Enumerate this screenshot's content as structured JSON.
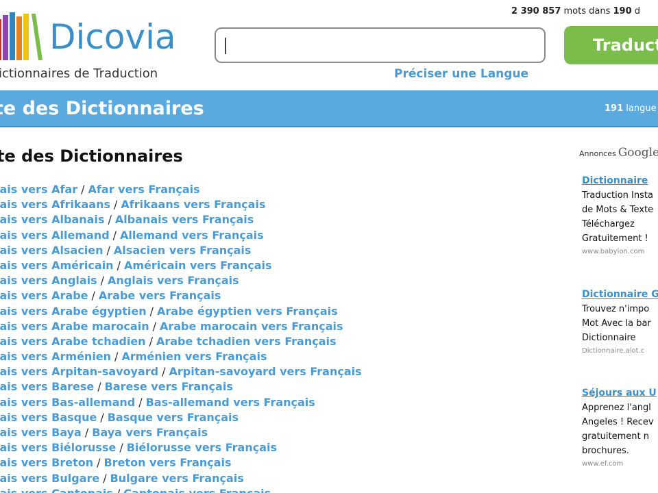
{
  "header": {
    "logo_text": "Dicovia",
    "tagline": "ictionnaires de Traduction",
    "word_count_number": "2 390 857",
    "word_count_mid": " mots dans ",
    "word_count_langs": "190",
    "word_count_tail": " d",
    "search": {
      "value": "",
      "placeholder": ""
    },
    "translate_button": "Traductio",
    "specify_language_link": "Préciser une Langue"
  },
  "banner": {
    "title": "te des Dictionnaires",
    "count_number": "191",
    "count_label": " langue"
  },
  "main": {
    "heading": "te des Dictionnaires",
    "separator": "/",
    "entries": [
      {
        "fr_to": "çais vers Afar",
        "to_fr": "Afar vers Français"
      },
      {
        "fr_to": "çais vers Afrikaans",
        "to_fr": "Afrikaans vers Français"
      },
      {
        "fr_to": "çais vers Albanais",
        "to_fr": "Albanais vers Français"
      },
      {
        "fr_to": "çais vers Allemand",
        "to_fr": "Allemand vers Français"
      },
      {
        "fr_to": "çais vers Alsacien",
        "to_fr": "Alsacien vers Français"
      },
      {
        "fr_to": "çais vers Américain",
        "to_fr": "Américain vers Français"
      },
      {
        "fr_to": "çais vers Anglais",
        "to_fr": "Anglais vers Français"
      },
      {
        "fr_to": "çais vers Arabe",
        "to_fr": "Arabe vers Français"
      },
      {
        "fr_to": "çais vers Arabe égyptien",
        "to_fr": "Arabe égyptien vers Français"
      },
      {
        "fr_to": "çais vers Arabe marocain",
        "to_fr": "Arabe marocain vers Français"
      },
      {
        "fr_to": "çais vers Arabe tchadien",
        "to_fr": "Arabe tchadien vers Français"
      },
      {
        "fr_to": "çais vers Arménien",
        "to_fr": "Arménien vers Français"
      },
      {
        "fr_to": "çais vers Arpitan-savoyard",
        "to_fr": "Arpitan-savoyard vers Français"
      },
      {
        "fr_to": "çais vers Barese",
        "to_fr": "Barese vers Français"
      },
      {
        "fr_to": "çais vers Bas-allemand",
        "to_fr": "Bas-allemand vers Français"
      },
      {
        "fr_to": "çais vers Basque",
        "to_fr": "Basque vers Français"
      },
      {
        "fr_to": "çais vers Baya",
        "to_fr": "Baya vers Français"
      },
      {
        "fr_to": "çais vers Biélorusse",
        "to_fr": "Biélorusse vers Français"
      },
      {
        "fr_to": "çais vers Breton",
        "to_fr": "Breton vers Français"
      },
      {
        "fr_to": "çais vers Bulgare",
        "to_fr": "Bulgare vers Français"
      },
      {
        "fr_to": "çais vers Cantonais",
        "to_fr": "Cantonais vers Français"
      }
    ]
  },
  "ads": {
    "label": "Annonces",
    "brand": "Google",
    "items": [
      {
        "title": "Dictionnaire",
        "lines": [
          "Traduction Insta",
          "de Mots & Texte",
          "Téléchargez",
          "Gratuitement !"
        ],
        "url": "www.babylon.com"
      },
      {
        "title": "Dictionnaire G",
        "lines": [
          "Trouvez n'impo",
          "Mot Avec la bar",
          "Dictionnaire"
        ],
        "url": "Dictionnaire.alot.c"
      },
      {
        "title": "Séjours aux U",
        "lines": [
          "Apprenez l'angl",
          "Angeles ! Recev",
          "gratuitement n",
          "brochures."
        ],
        "url": "www.ef.com"
      }
    ]
  },
  "colors": {
    "brand_blue": "#3a8fc9",
    "link_blue": "#4a9ad4",
    "banner_blue": "#5aaae0",
    "button_green": "#7bbd4a"
  },
  "icons": {
    "logo": "books-logo-icon"
  }
}
